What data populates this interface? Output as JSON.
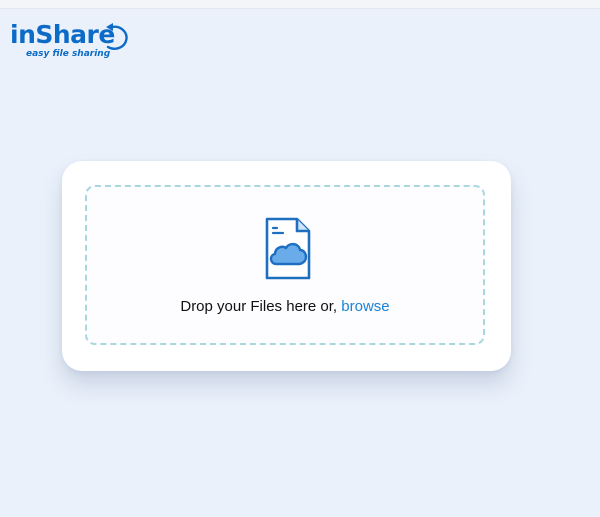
{
  "logo": {
    "title": "inShare",
    "tagline": "easy file sharing"
  },
  "upload": {
    "drop_text": "Drop your Files here or,",
    "browse_label": "browse"
  },
  "icons": {
    "logo_arc": "circular-arrow-icon",
    "file": "file-cloud-icon"
  },
  "colors": {
    "page_background": "#eaf1fb",
    "brand_blue": "#0d6bc8",
    "link_blue": "#1a83d6",
    "dashed_border": "#a8d8de",
    "cloud_fill": "#6aabea"
  }
}
